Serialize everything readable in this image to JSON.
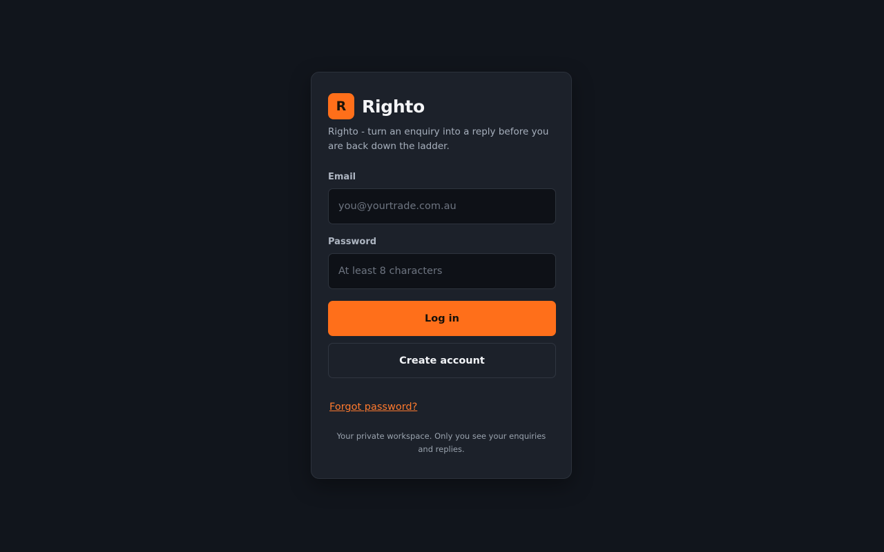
{
  "brand": {
    "logo_letter": "R",
    "name": "Righto",
    "tagline": "Righto - turn an enquiry into a reply before you are back down the ladder."
  },
  "form": {
    "email_label": "Email",
    "email_placeholder": "you@yourtrade.com.au",
    "email_value": "",
    "password_label": "Password",
    "password_placeholder": "At least 8 characters",
    "password_value": ""
  },
  "actions": {
    "login_label": "Log in",
    "create_account_label": "Create account",
    "forgot_password_label": "Forgot password?"
  },
  "footer": {
    "note": "Your private workspace. Only you see your enquiries and replies."
  },
  "colors": {
    "accent": "#ff6f1a",
    "background": "#11151c",
    "card": "#1c212a"
  }
}
